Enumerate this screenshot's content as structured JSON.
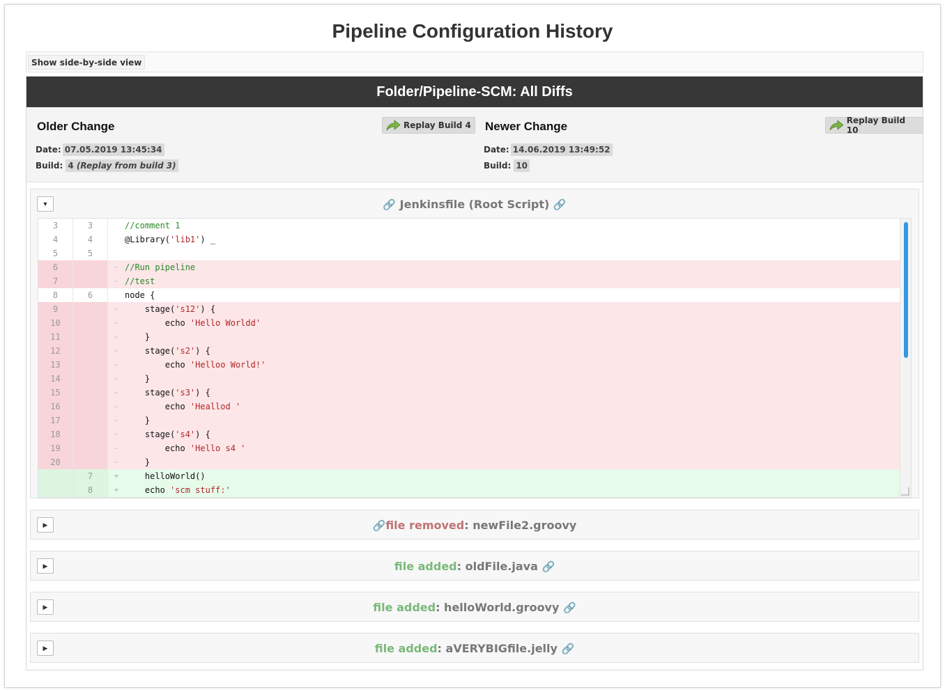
{
  "page": {
    "title": "Pipeline Configuration History"
  },
  "toolbar": {
    "side_by_side_label": "Show side-by-side view"
  },
  "header": {
    "title": "Folder/Pipeline-SCM: All Diffs"
  },
  "older": {
    "heading": "Older Change",
    "replay_label": "Replay Build 4",
    "date_label": "Date:",
    "date_value": "07.05.2019 13:45:34",
    "build_label": "Build:",
    "build_number": "4",
    "build_note": "(Replay from build 3)"
  },
  "newer": {
    "heading": "Newer Change",
    "replay_label": "Replay Build 10",
    "date_label": "Date:",
    "date_value": "14.06.2019 13:49:52",
    "build_label": "Build:",
    "build_number": "10"
  },
  "files": [
    {
      "status": "",
      "name": "Jenkinsfile (Root Script)",
      "expanded": true,
      "toggle": "▼"
    },
    {
      "status": "file removed",
      "sep": ": ",
      "name": "newFile2.groovy",
      "expanded": false,
      "toggle": "▶"
    },
    {
      "status": "file added",
      "sep": ": ",
      "name": "oldFile.java",
      "expanded": false,
      "toggle": "▶"
    },
    {
      "status": "file added",
      "sep": ": ",
      "name": "helloWorld.groovy",
      "expanded": false,
      "toggle": "▶"
    },
    {
      "status": "file added",
      "sep": ": ",
      "name": "aVERYBIGfile.jelly",
      "expanded": false,
      "toggle": "▶"
    }
  ],
  "diff_lines": [
    {
      "old": "3",
      "new": "3",
      "sign": "",
      "type": "ctx",
      "code": "//comment 1"
    },
    {
      "old": "4",
      "new": "4",
      "sign": "",
      "type": "ctx",
      "code": "@Library('lib1') _"
    },
    {
      "old": "5",
      "new": "5",
      "sign": "",
      "type": "ctx",
      "code": ""
    },
    {
      "old": "6",
      "new": "",
      "sign": "-",
      "type": "del",
      "code": "//Run pipeline"
    },
    {
      "old": "7",
      "new": "",
      "sign": "-",
      "type": "del",
      "code": "//test"
    },
    {
      "old": "8",
      "new": "6",
      "sign": "",
      "type": "ctx",
      "code": "node {"
    },
    {
      "old": "9",
      "new": "",
      "sign": "-",
      "type": "del",
      "code": "    stage('s12') {"
    },
    {
      "old": "10",
      "new": "",
      "sign": "-",
      "type": "del",
      "code": "        echo 'Hello Worldd'"
    },
    {
      "old": "11",
      "new": "",
      "sign": "-",
      "type": "del",
      "code": "    }"
    },
    {
      "old": "12",
      "new": "",
      "sign": "-",
      "type": "del",
      "code": "    stage('s2') {"
    },
    {
      "old": "13",
      "new": "",
      "sign": "-",
      "type": "del",
      "code": "        echo 'Helloo World!'"
    },
    {
      "old": "14",
      "new": "",
      "sign": "-",
      "type": "del",
      "code": "    }"
    },
    {
      "old": "15",
      "new": "",
      "sign": "-",
      "type": "del",
      "code": "    stage('s3') {"
    },
    {
      "old": "16",
      "new": "",
      "sign": "-",
      "type": "del",
      "code": "        echo 'Heallod '"
    },
    {
      "old": "17",
      "new": "",
      "sign": "-",
      "type": "del",
      "code": "    }"
    },
    {
      "old": "18",
      "new": "",
      "sign": "-",
      "type": "del",
      "code": "    stage('s4') {"
    },
    {
      "old": "19",
      "new": "",
      "sign": "-",
      "type": "del",
      "code": "        echo 'Hello s4 '"
    },
    {
      "old": "20",
      "new": "",
      "sign": "-",
      "type": "del",
      "code": "    }"
    },
    {
      "old": "",
      "new": "7",
      "sign": "+",
      "type": "add",
      "code": "    helloWorld()"
    },
    {
      "old": "",
      "new": "8",
      "sign": "+",
      "type": "add",
      "code": "    echo 'scm stuff:'"
    }
  ],
  "colors": {
    "header_bg": "#373737",
    "deleted_bg": "#fce6e8",
    "added_bg": "#e6fbea",
    "status_added": "#7ab87a",
    "status_removed": "#c07373",
    "scroll_thumb": "#3399e0"
  },
  "icons": {
    "replay": "replay-arrow-icon",
    "link": "link-icon",
    "expand": "triangle-icon"
  }
}
